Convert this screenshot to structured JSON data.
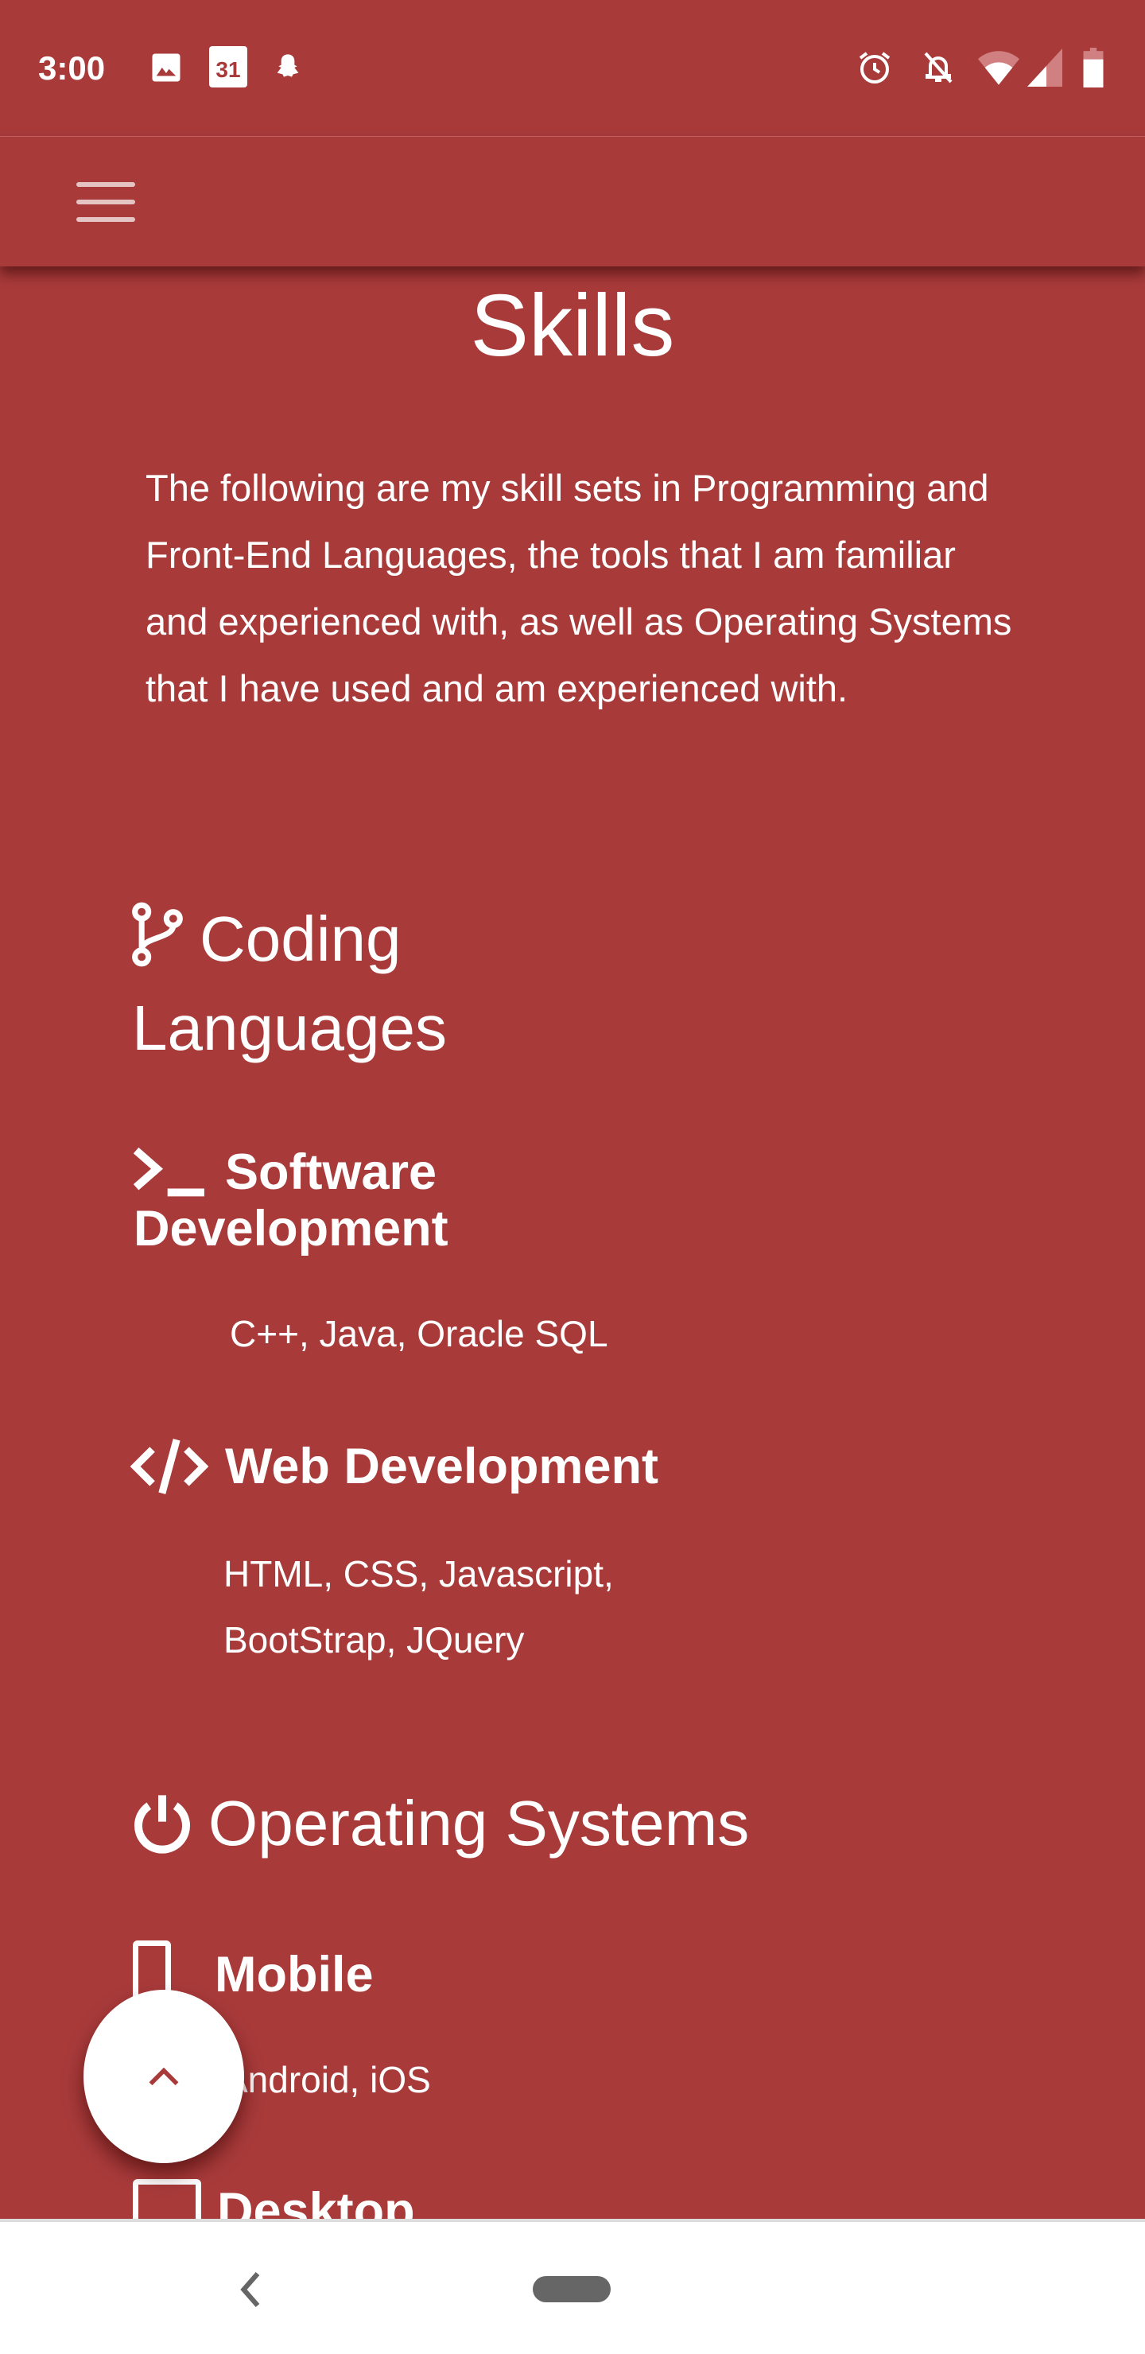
{
  "status_bar": {
    "time": "3:00",
    "left_icons": [
      "image-icon",
      "calendar-icon",
      "snapchat-icon"
    ],
    "calendar_day": "31",
    "right_icons": [
      "alarm-icon",
      "notifications-off-icon",
      "wifi-icon",
      "signal-icon",
      "battery-icon"
    ]
  },
  "toolbar": {
    "menu_icon": "hamburger-menu-icon"
  },
  "page": {
    "title": "Skills",
    "intro": "The following are my skill sets in Programming and Front-End Languages, the tools that I am familiar and experienced with, as well as Operating Systems that I have used and am experienced with.",
    "coding": {
      "heading_line1": "Coding",
      "heading_line2": "Languages",
      "software": {
        "title_line1": "Software",
        "title_line2": "Development",
        "items": "C++, Java, Oracle SQL"
      },
      "web": {
        "title": "Web Development",
        "items_line1": "HTML, CSS, Javascript,",
        "items_line2": "BootStrap, JQuery"
      }
    },
    "os": {
      "heading": "Operating Systems",
      "mobile": {
        "title": "Mobile",
        "items": "Android, iOS"
      },
      "desktop": {
        "title": "Desktop"
      }
    }
  },
  "colors": {
    "background": "#a83a3a",
    "fab": "#ffffff",
    "nav": "#ffffff"
  }
}
